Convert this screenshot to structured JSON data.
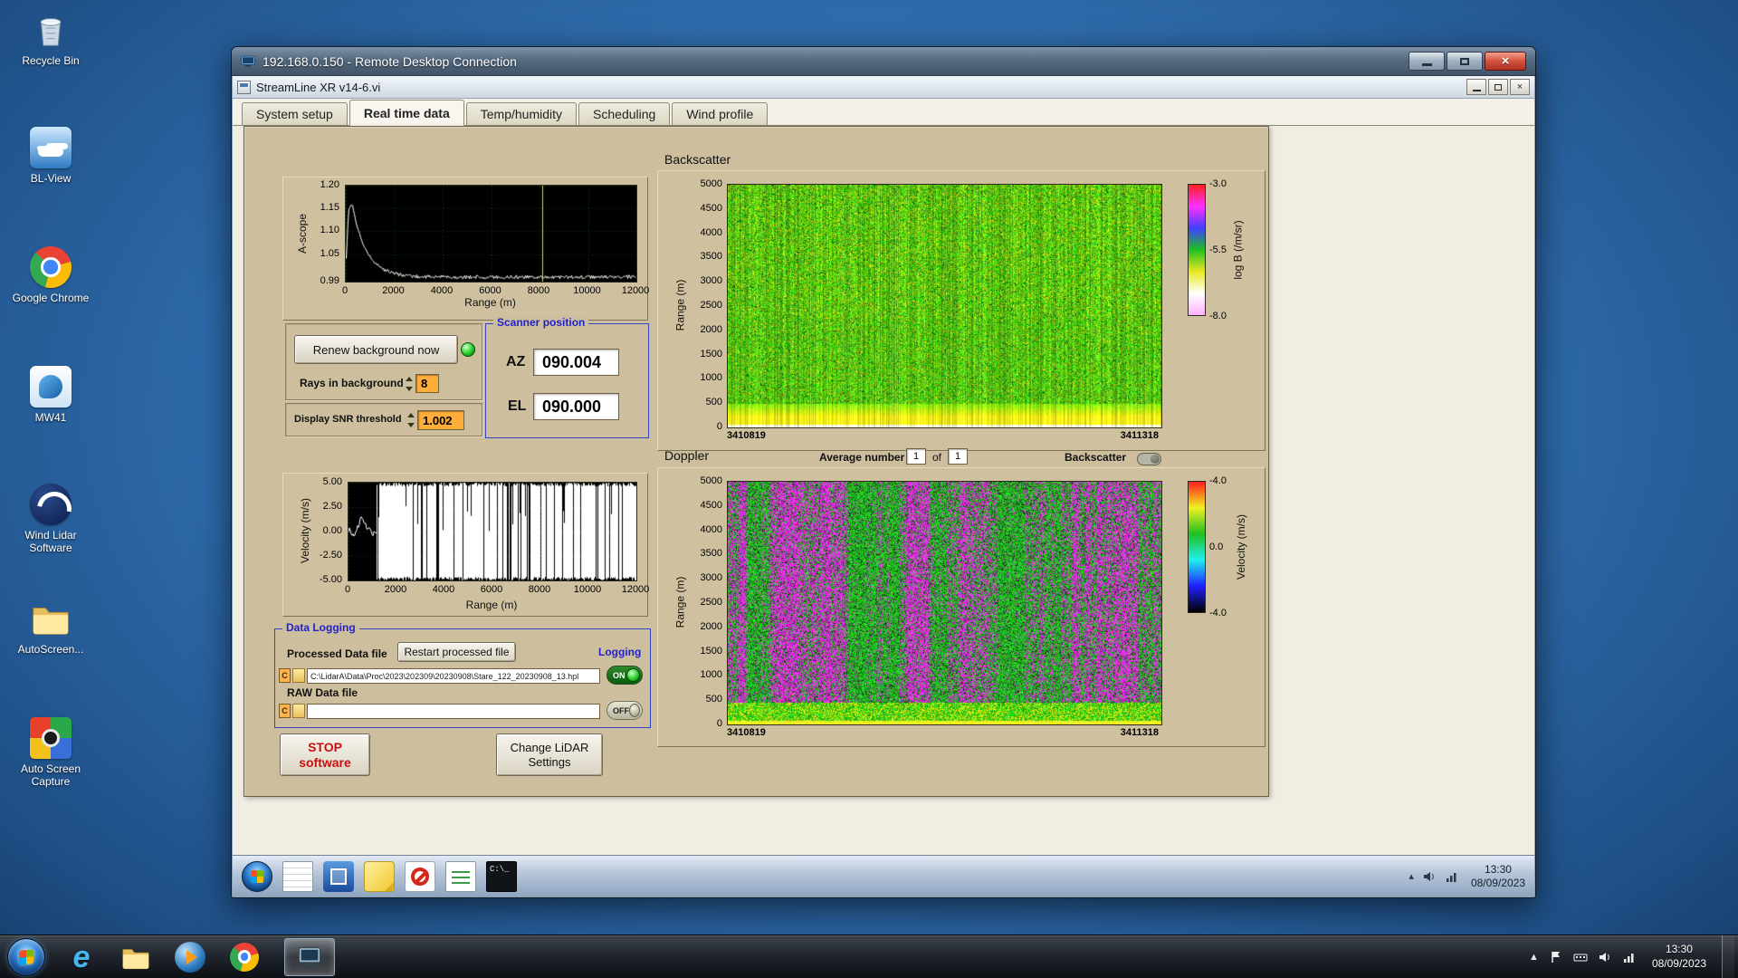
{
  "colors": {
    "panel_tan": "#cdbf9d",
    "panel_border": "#6e6248",
    "group_blue": "#2222cc",
    "field_orange": "#ffae3c",
    "on_green": "#1a7a1a",
    "stop_red": "#c81010"
  },
  "desktop": {
    "icons": [
      {
        "name": "recycle-bin",
        "label": "Recycle Bin"
      },
      {
        "name": "bl-view",
        "label": "BL-View"
      },
      {
        "name": "google-chrome",
        "label": "Google Chrome"
      },
      {
        "name": "mw41",
        "label": "MW41"
      },
      {
        "name": "wind-lidar-software",
        "label": "Wind Lidar Software"
      },
      {
        "name": "autoscreen-folder",
        "label": "AutoScreen..."
      },
      {
        "name": "auto-screen-capture",
        "label": "Auto Screen Capture"
      }
    ]
  },
  "rdp_window": {
    "title": "192.168.0.150 - Remote Desktop Connection"
  },
  "app_window": {
    "title": "StreamLine XR v14-6.vi",
    "tabs": [
      "System setup",
      "Real time data",
      "Temp/humidity",
      "Scheduling",
      "Wind profile"
    ],
    "active_tab": "Real time data"
  },
  "panel": {
    "renew_button": "Renew background now",
    "rays_label": "Rays in background",
    "rays_value": "8",
    "snr_label": "Display SNR threshold",
    "snr_value": "1.002",
    "scanner": {
      "title": "Scanner position",
      "az_label": "AZ",
      "az_value": "090.004",
      "el_label": "EL",
      "el_value": "090.000"
    },
    "average_label": "Average number",
    "average_value": "1",
    "of_label": "of",
    "average_of_value": "1",
    "backscatter_toggle_label": "Backscatter",
    "logging": {
      "title": "Data Logging",
      "processed_label": "Processed Data file",
      "restart_button": "Restart processed file",
      "logging_label": "Logging",
      "path_drive_badge": "C",
      "processed_path": "C:\\LidarA\\Data\\Proc\\2023\\202309\\20230908\\Stare_122_20230908_13.hpl",
      "processed_switch": "ON",
      "raw_label": "RAW Data file",
      "raw_path": "",
      "raw_switch": "OFF"
    },
    "stop_button_line1": "STOP",
    "stop_button_line2": "software",
    "settings_button_line1": "Change LiDAR",
    "settings_button_line2": "Settings"
  },
  "remote_taskbar": {
    "cmd_icon_text": "C:\\_",
    "time": "13:30",
    "date": "08/09/2023"
  },
  "host_taskbar": {
    "time": "13:30",
    "date": "08/09/2023"
  },
  "chart_data": [
    {
      "id": "a-scope",
      "type": "line",
      "ylabel": "A-scope",
      "xlabel": "Range (m)",
      "xlim": [
        0,
        12000
      ],
      "ylim": [
        0.99,
        1.2
      ],
      "xticks": [
        0,
        2000,
        4000,
        6000,
        8000,
        10000,
        12000
      ],
      "yticks": [
        "1.20",
        "1.15",
        "1.10",
        "1.05",
        "0.99"
      ],
      "cursor_x": 8100,
      "cursor_color": "#d8e800",
      "grid": true,
      "plot_bg": "#000000",
      "line_color": "#ffffff",
      "noise_amplitude": 0.004,
      "series": [
        {
          "name": "background amplitude",
          "x": [
            0,
            100,
            250,
            400,
            700,
            1100,
            1600,
            2200,
            3000,
            5000,
            8000,
            12000
          ],
          "y": [
            1.04,
            1.15,
            1.16,
            1.12,
            1.07,
            1.035,
            1.015,
            1.005,
            1.001,
            1.0,
            1.0,
            1.0
          ]
        }
      ]
    },
    {
      "id": "backscatter",
      "type": "heatmap",
      "title": "Backscatter",
      "ylabel": "Range (m)",
      "ylim": [
        0,
        5000
      ],
      "yticks": [
        "5000",
        "4500",
        "4000",
        "3500",
        "3000",
        "2500",
        "2000",
        "1500",
        "1000",
        "500",
        "0"
      ],
      "xticks": [
        "3410819",
        "3411318"
      ],
      "colorbar_label": "log B (/m/sr)",
      "colorbar_ticks": [
        "-3.0",
        "-5.5",
        "-8.0"
      ],
      "colorbar_colors": [
        "#ff2020",
        "#ff30ff",
        "#4040ff",
        "#20c020",
        "#e8e820",
        "#ffffff",
        "#ffb0ff"
      ],
      "description": "Time-height backscatter field: green speckle noise aloft, strong yellow-to-white aerosol return below ~400 m"
    },
    {
      "id": "doppler",
      "type": "heatmap",
      "title": "Doppler",
      "ylabel": "Range (m)",
      "ylim": [
        0,
        5000
      ],
      "yticks": [
        "5000",
        "4500",
        "4000",
        "3500",
        "3000",
        "2500",
        "2000",
        "1500",
        "1000",
        "500",
        "0"
      ],
      "xticks": [
        "3410819",
        "3411318"
      ],
      "colorbar_label": "Velocity (m/s)",
      "colorbar_ticks": [
        "-4.0",
        "0.0",
        "-4.0"
      ],
      "colorbar_colors": [
        "#ff2020",
        "#f0f020",
        "#20c020",
        "#20f0f0",
        "#2020ff",
        "#000000"
      ],
      "description": "Time-height Doppler velocity: saturated magenta/green noise streaks aloft, coherent green-yellow velocities below ~600 m"
    },
    {
      "id": "velocity",
      "type": "line",
      "ylabel": "Velocity (m/s)",
      "xlabel": "Range (m)",
      "xlim": [
        0,
        12000
      ],
      "ylim": [
        -5,
        5
      ],
      "xticks": [
        0,
        2000,
        4000,
        6000,
        8000,
        10000,
        12000
      ],
      "yticks": [
        "5.00",
        "2.50",
        "0.00",
        "-2.50",
        "-5.00"
      ],
      "plot_bg": "#000000",
      "line_color": "#ffffff",
      "series": [
        {
          "name": "radial velocity",
          "x": [
            0,
            200,
            400,
            600,
            800,
            1000,
            1200
          ],
          "y": [
            0.2,
            -0.3,
            0.4,
            1.6,
            0.3,
            -0.2,
            0.1
          ]
        }
      ],
      "noise_region": {
        "x_start": 1200,
        "x_end": 12000,
        "behavior": "saturated noise spanning full ±5 m/s"
      }
    }
  ]
}
